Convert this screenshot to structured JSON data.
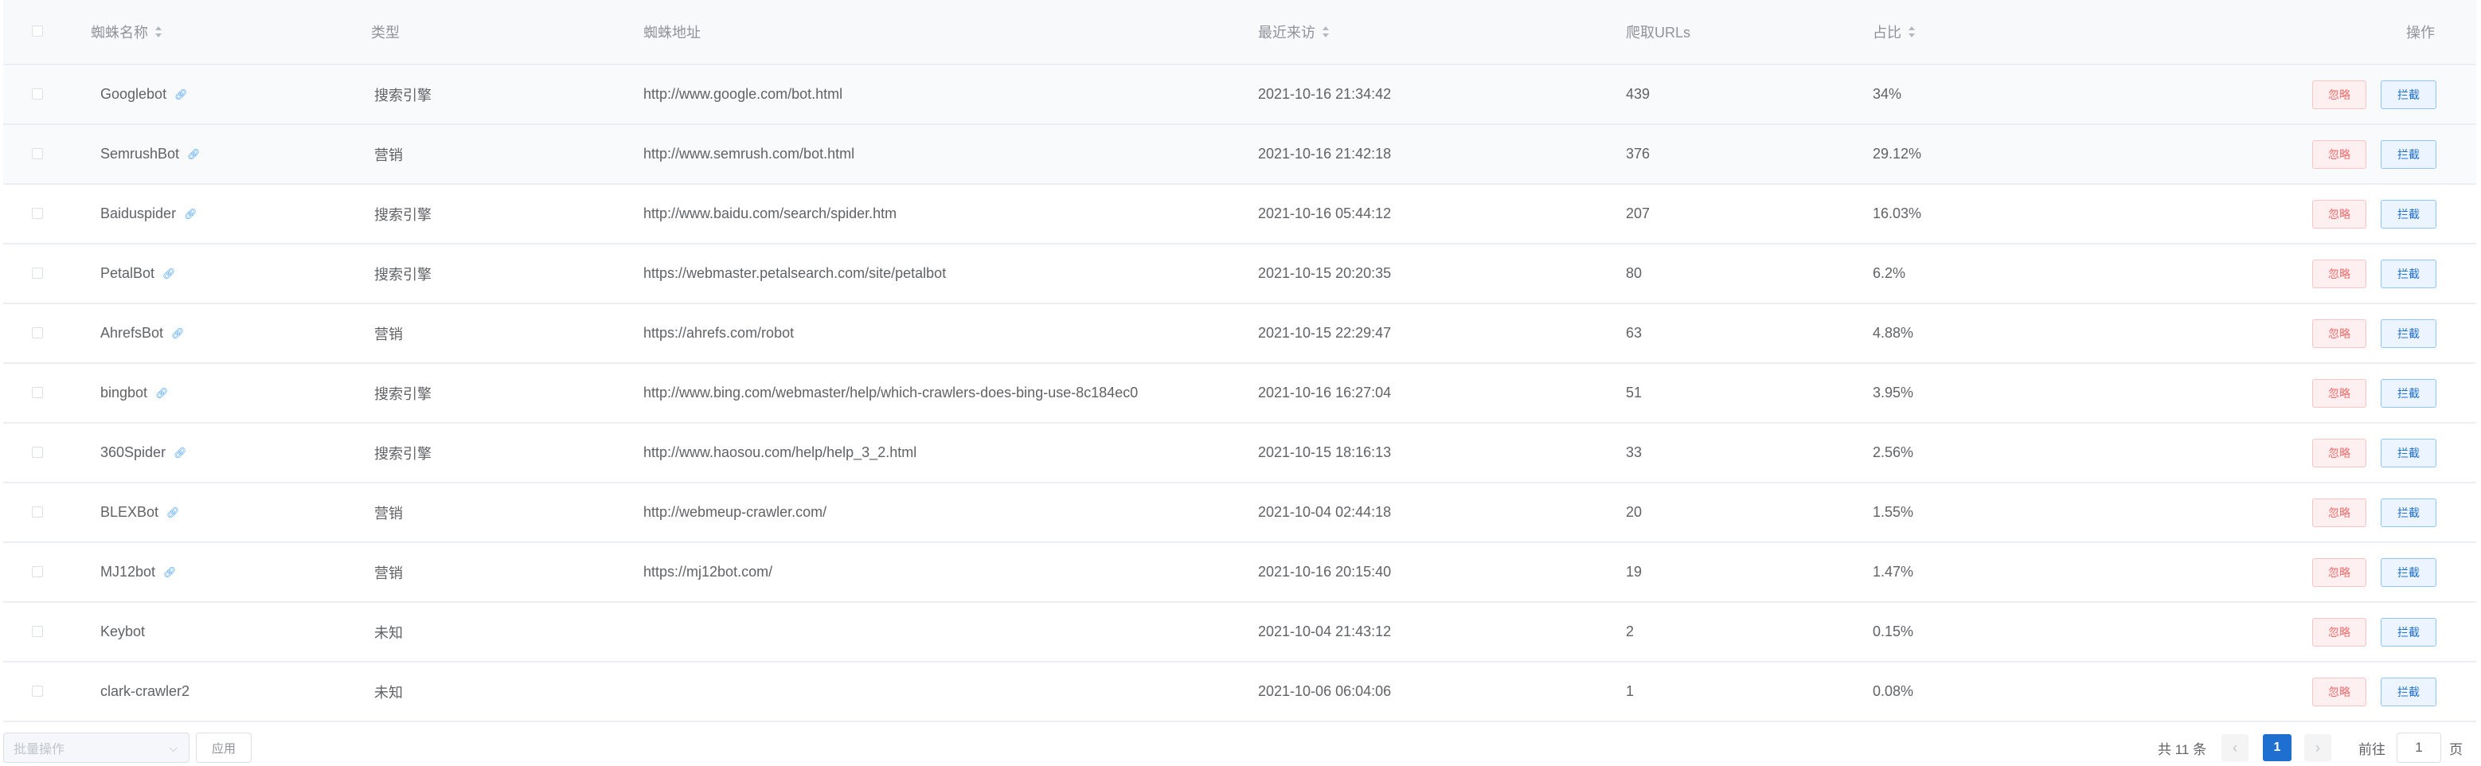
{
  "table": {
    "headers": {
      "name": "蜘蛛名称",
      "type": "类型",
      "address": "蜘蛛地址",
      "last_visit": "最近来访",
      "urls": "爬取URLs",
      "ratio": "占比",
      "actions": "操作"
    },
    "rows": [
      {
        "name": "Googlebot",
        "has_link": true,
        "type": "搜索引擎",
        "address": "http://www.google.com/bot.html",
        "last_visit": "2021-10-16 21:34:42",
        "urls": "439",
        "ratio": "34%",
        "ignore": "忽略",
        "block": "拦截"
      },
      {
        "name": "SemrushBot",
        "has_link": true,
        "type": "营销",
        "address": "http://www.semrush.com/bot.html",
        "last_visit": "2021-10-16 21:42:18",
        "urls": "376",
        "ratio": "29.12%",
        "ignore": "忽略",
        "block": "拦截"
      },
      {
        "name": "Baiduspider",
        "has_link": true,
        "type": "搜索引擎",
        "address": "http://www.baidu.com/search/spider.htm",
        "last_visit": "2021-10-16 05:44:12",
        "urls": "207",
        "ratio": "16.03%",
        "ignore": "忽略",
        "block": "拦截"
      },
      {
        "name": "PetalBot",
        "has_link": true,
        "type": "搜索引擎",
        "address": "https://webmaster.petalsearch.com/site/petalbot",
        "last_visit": "2021-10-15 20:20:35",
        "urls": "80",
        "ratio": "6.2%",
        "ignore": "忽略",
        "block": "拦截"
      },
      {
        "name": "AhrefsBot",
        "has_link": true,
        "type": "营销",
        "address": "https://ahrefs.com/robot",
        "last_visit": "2021-10-15 22:29:47",
        "urls": "63",
        "ratio": "4.88%",
        "ignore": "忽略",
        "block": "拦截"
      },
      {
        "name": "bingbot",
        "has_link": true,
        "type": "搜索引擎",
        "address": "http://www.bing.com/webmaster/help/which-crawlers-does-bing-use-8c184ec0",
        "last_visit": "2021-10-16 16:27:04",
        "urls": "51",
        "ratio": "3.95%",
        "ignore": "忽略",
        "block": "拦截"
      },
      {
        "name": "360Spider",
        "has_link": true,
        "type": "搜索引擎",
        "address": "http://www.haosou.com/help/help_3_2.html",
        "last_visit": "2021-10-15 18:16:13",
        "urls": "33",
        "ratio": "2.56%",
        "ignore": "忽略",
        "block": "拦截"
      },
      {
        "name": "BLEXBot",
        "has_link": true,
        "type": "营销",
        "address": "http://webmeup-crawler.com/",
        "last_visit": "2021-10-04 02:44:18",
        "urls": "20",
        "ratio": "1.55%",
        "ignore": "忽略",
        "block": "拦截"
      },
      {
        "name": "MJ12bot",
        "has_link": true,
        "type": "营销",
        "address": "https://mj12bot.com/",
        "last_visit": "2021-10-16 20:15:40",
        "urls": "19",
        "ratio": "1.47%",
        "ignore": "忽略",
        "block": "拦截"
      },
      {
        "name": "Keybot",
        "has_link": false,
        "type": "未知",
        "address": "",
        "last_visit": "2021-10-04 21:43:12",
        "urls": "2",
        "ratio": "0.15%",
        "ignore": "忽略",
        "block": "拦截"
      },
      {
        "name": "clark-crawler2",
        "has_link": false,
        "type": "未知",
        "address": "",
        "last_visit": "2021-10-06 06:04:06",
        "urls": "1",
        "ratio": "0.08%",
        "ignore": "忽略",
        "block": "拦截"
      }
    ]
  },
  "footer": {
    "batch_placeholder": "批量操作",
    "apply_label": "应用",
    "total_text": "共 11 条",
    "current_page": "1",
    "goto_prefix": "前往",
    "goto_value": "1",
    "goto_suffix": "页"
  },
  "icons": {
    "link": "link-icon",
    "prev": "chevron-left-icon",
    "next": "chevron-right-icon",
    "dropdown": "chevron-down-icon",
    "sort": "sort-caret-icon"
  },
  "colors": {
    "primary": "#1f6fd1",
    "danger": "#f56c6c",
    "link": "#409eff"
  }
}
